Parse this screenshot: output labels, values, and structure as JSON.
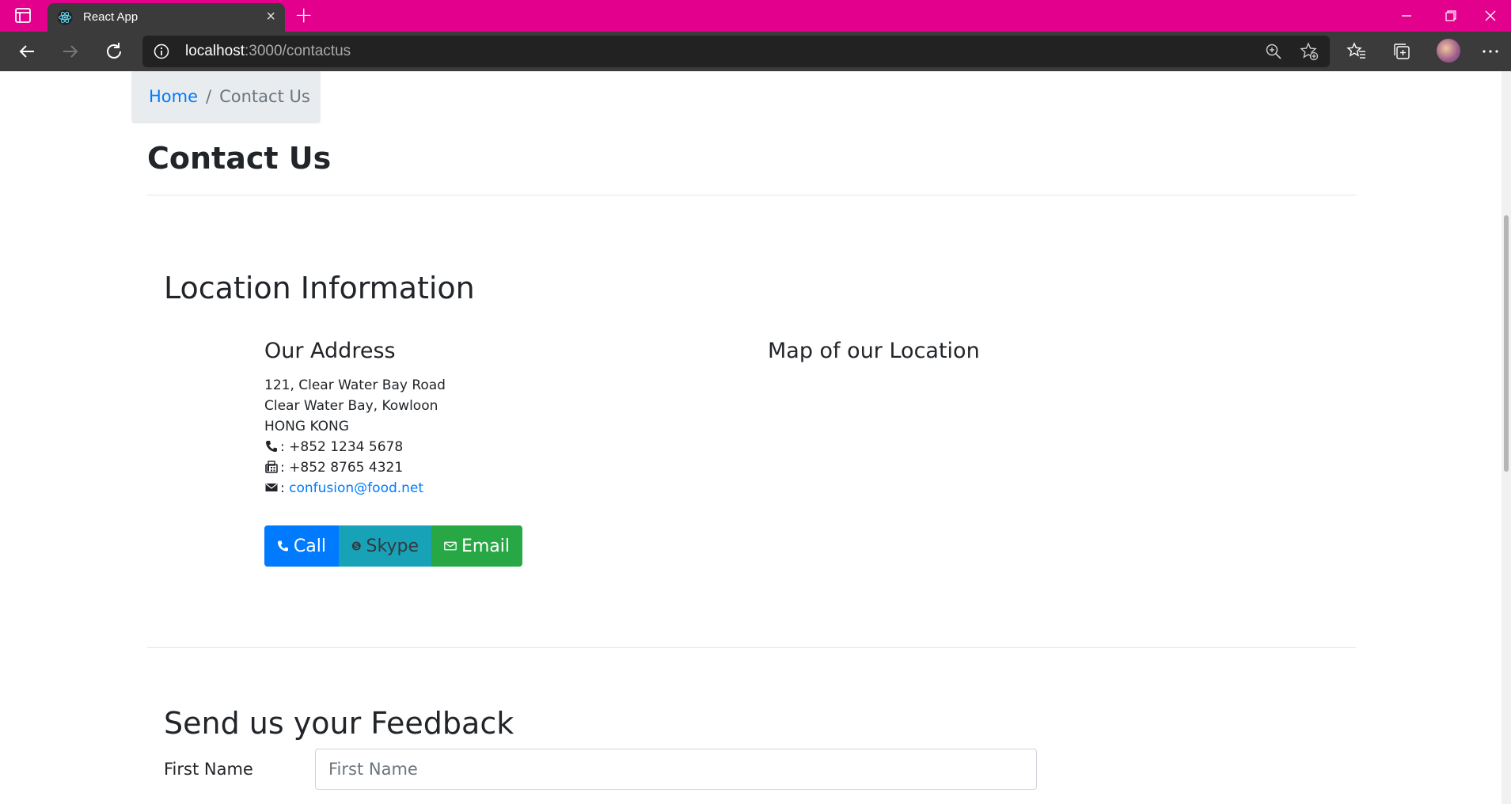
{
  "browser": {
    "tab_title": "React App",
    "url_host": "localhost",
    "url_rest": ":3000/contactus",
    "new_tab_label": "+",
    "close_tab_label": "×"
  },
  "breadcrumb": {
    "home_label": "Home",
    "separator": "/",
    "current_label": "Contact Us"
  },
  "page_title": "Contact Us",
  "location": {
    "heading": "Location Information",
    "address_heading": "Our Address",
    "map_heading": "Map of our Location",
    "address_line1": "121, Clear Water Bay Road",
    "address_line2": "Clear Water Bay, Kowloon",
    "address_line3": "HONG KONG",
    "phone": ": +852 1234 5678",
    "fax": ": +852 8765 4321",
    "email_prefix": ":",
    "email": "confusion@food.net"
  },
  "buttons": {
    "call_label": "Call",
    "skype_label": "Skype",
    "email_label": "Email"
  },
  "feedback": {
    "heading": "Send us your Feedback",
    "firstname_label": "First Name",
    "firstname_placeholder": "First Name"
  },
  "colors": {
    "tabbar": "#e3008c",
    "primary": "#007bff",
    "info": "#17a2b8",
    "success": "#28a745"
  }
}
